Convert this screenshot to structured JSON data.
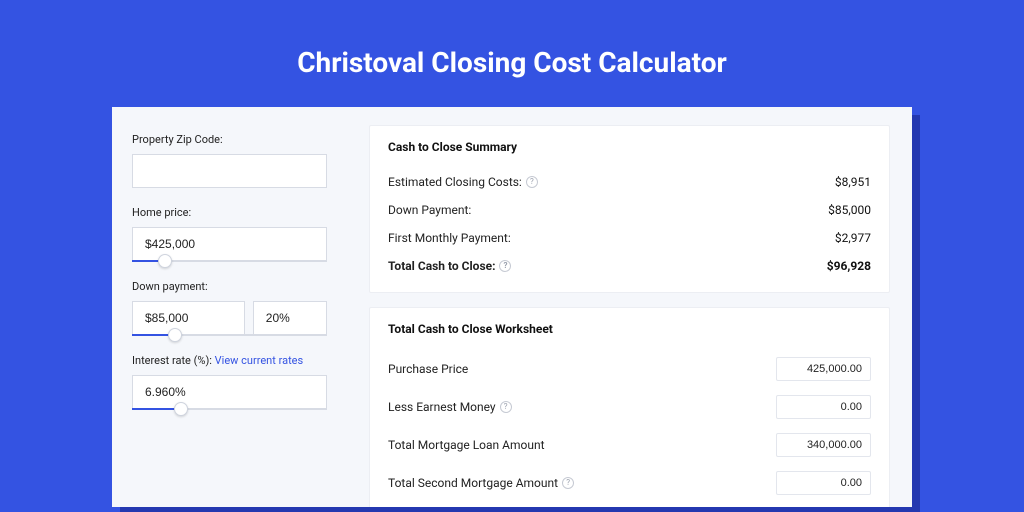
{
  "title": "Christoval Closing Cost Calculator",
  "left": {
    "zip_label": "Property Zip Code:",
    "zip_value": "",
    "home_price_label": "Home price:",
    "home_price_value": "$425,000",
    "home_price_slider_pct": 17,
    "down_label": "Down payment:",
    "down_value": "$85,000",
    "down_pct_value": "20%",
    "down_slider_pct": 22,
    "rate_label": "Interest rate (%):",
    "rate_link": "View current rates",
    "rate_value": "6.960%",
    "rate_slider_pct": 25
  },
  "summary": {
    "title": "Cash to Close Summary",
    "rows": [
      {
        "label": "Estimated Closing Costs:",
        "value": "$8,951",
        "help": true,
        "bold": false
      },
      {
        "label": "Down Payment:",
        "value": "$85,000",
        "help": false,
        "bold": false
      },
      {
        "label": "First Monthly Payment:",
        "value": "$2,977",
        "help": false,
        "bold": false
      },
      {
        "label": "Total Cash to Close:",
        "value": "$96,928",
        "help": true,
        "bold": true
      }
    ]
  },
  "worksheet": {
    "title": "Total Cash to Close Worksheet",
    "rows": [
      {
        "label": "Purchase Price",
        "value": "425,000.00",
        "help": false
      },
      {
        "label": "Less Earnest Money",
        "value": "0.00",
        "help": true
      },
      {
        "label": "Total Mortgage Loan Amount",
        "value": "340,000.00",
        "help": false
      },
      {
        "label": "Total Second Mortgage Amount",
        "value": "0.00",
        "help": true
      }
    ]
  }
}
